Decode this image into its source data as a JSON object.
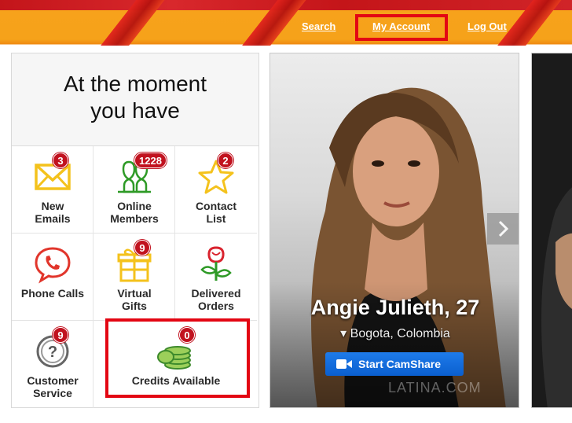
{
  "header": {
    "nav": [
      {
        "label": "Search"
      },
      {
        "label": "My Account"
      },
      {
        "label": "Log Out"
      }
    ],
    "brand_color": "#f6a21a",
    "highlight_color": "#e30613"
  },
  "summary": {
    "title_line1": "At the moment",
    "title_line2": "you have",
    "tiles": [
      {
        "icon": "envelope-icon",
        "label_line1": "New",
        "label_line2": "Emails",
        "badge": "3"
      },
      {
        "icon": "users-icon",
        "label_line1": "Online",
        "label_line2": "Members",
        "badge": "1228"
      },
      {
        "icon": "star-icon",
        "label_line1": "Contact",
        "label_line2": "List",
        "badge": "2"
      },
      {
        "icon": "phone-icon",
        "label_line1": "Phone Calls",
        "label_line2": "",
        "badge": ""
      },
      {
        "icon": "gift-icon",
        "label_line1": "Virtual",
        "label_line2": "Gifts",
        "badge": "9"
      },
      {
        "icon": "rose-icon",
        "label_line1": "Delivered",
        "label_line2": "Orders",
        "badge": ""
      },
      {
        "icon": "help-icon",
        "label_line1": "Customer",
        "label_line2": "Service",
        "badge": "9"
      },
      {
        "icon": "coins-icon",
        "label_line1": "Credits Available",
        "label_line2": "",
        "badge": "0"
      }
    ]
  },
  "profile": {
    "name": "Angie Julieth, 27",
    "location": "Bogota, Colombia",
    "camshare_label": "Start CamShare",
    "watermark": "LATINA.COM",
    "camshare_color": "#1565d8"
  }
}
